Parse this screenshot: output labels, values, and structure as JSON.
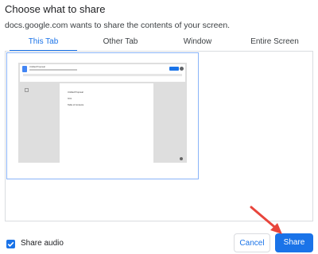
{
  "dialog": {
    "title": "Choose what to share",
    "subtitle": "docs.google.com wants to share the contents of your screen."
  },
  "tabs": [
    {
      "label": "This Tab",
      "active": true
    },
    {
      "label": "Other Tab",
      "active": false
    },
    {
      "label": "Window",
      "active": false
    },
    {
      "label": "Entire Screen",
      "active": false
    }
  ],
  "preview": {
    "doc_title": "Untitled Proposal",
    "lines": [
      "Untitled Proposal",
      "Intro",
      "Table of Contents"
    ]
  },
  "footer": {
    "share_audio_label": "Share audio",
    "share_audio_checked": true,
    "cancel_label": "Cancel",
    "share_label": "Share"
  },
  "colors": {
    "accent": "#1a73e8",
    "annotation_arrow": "#e8453c"
  }
}
